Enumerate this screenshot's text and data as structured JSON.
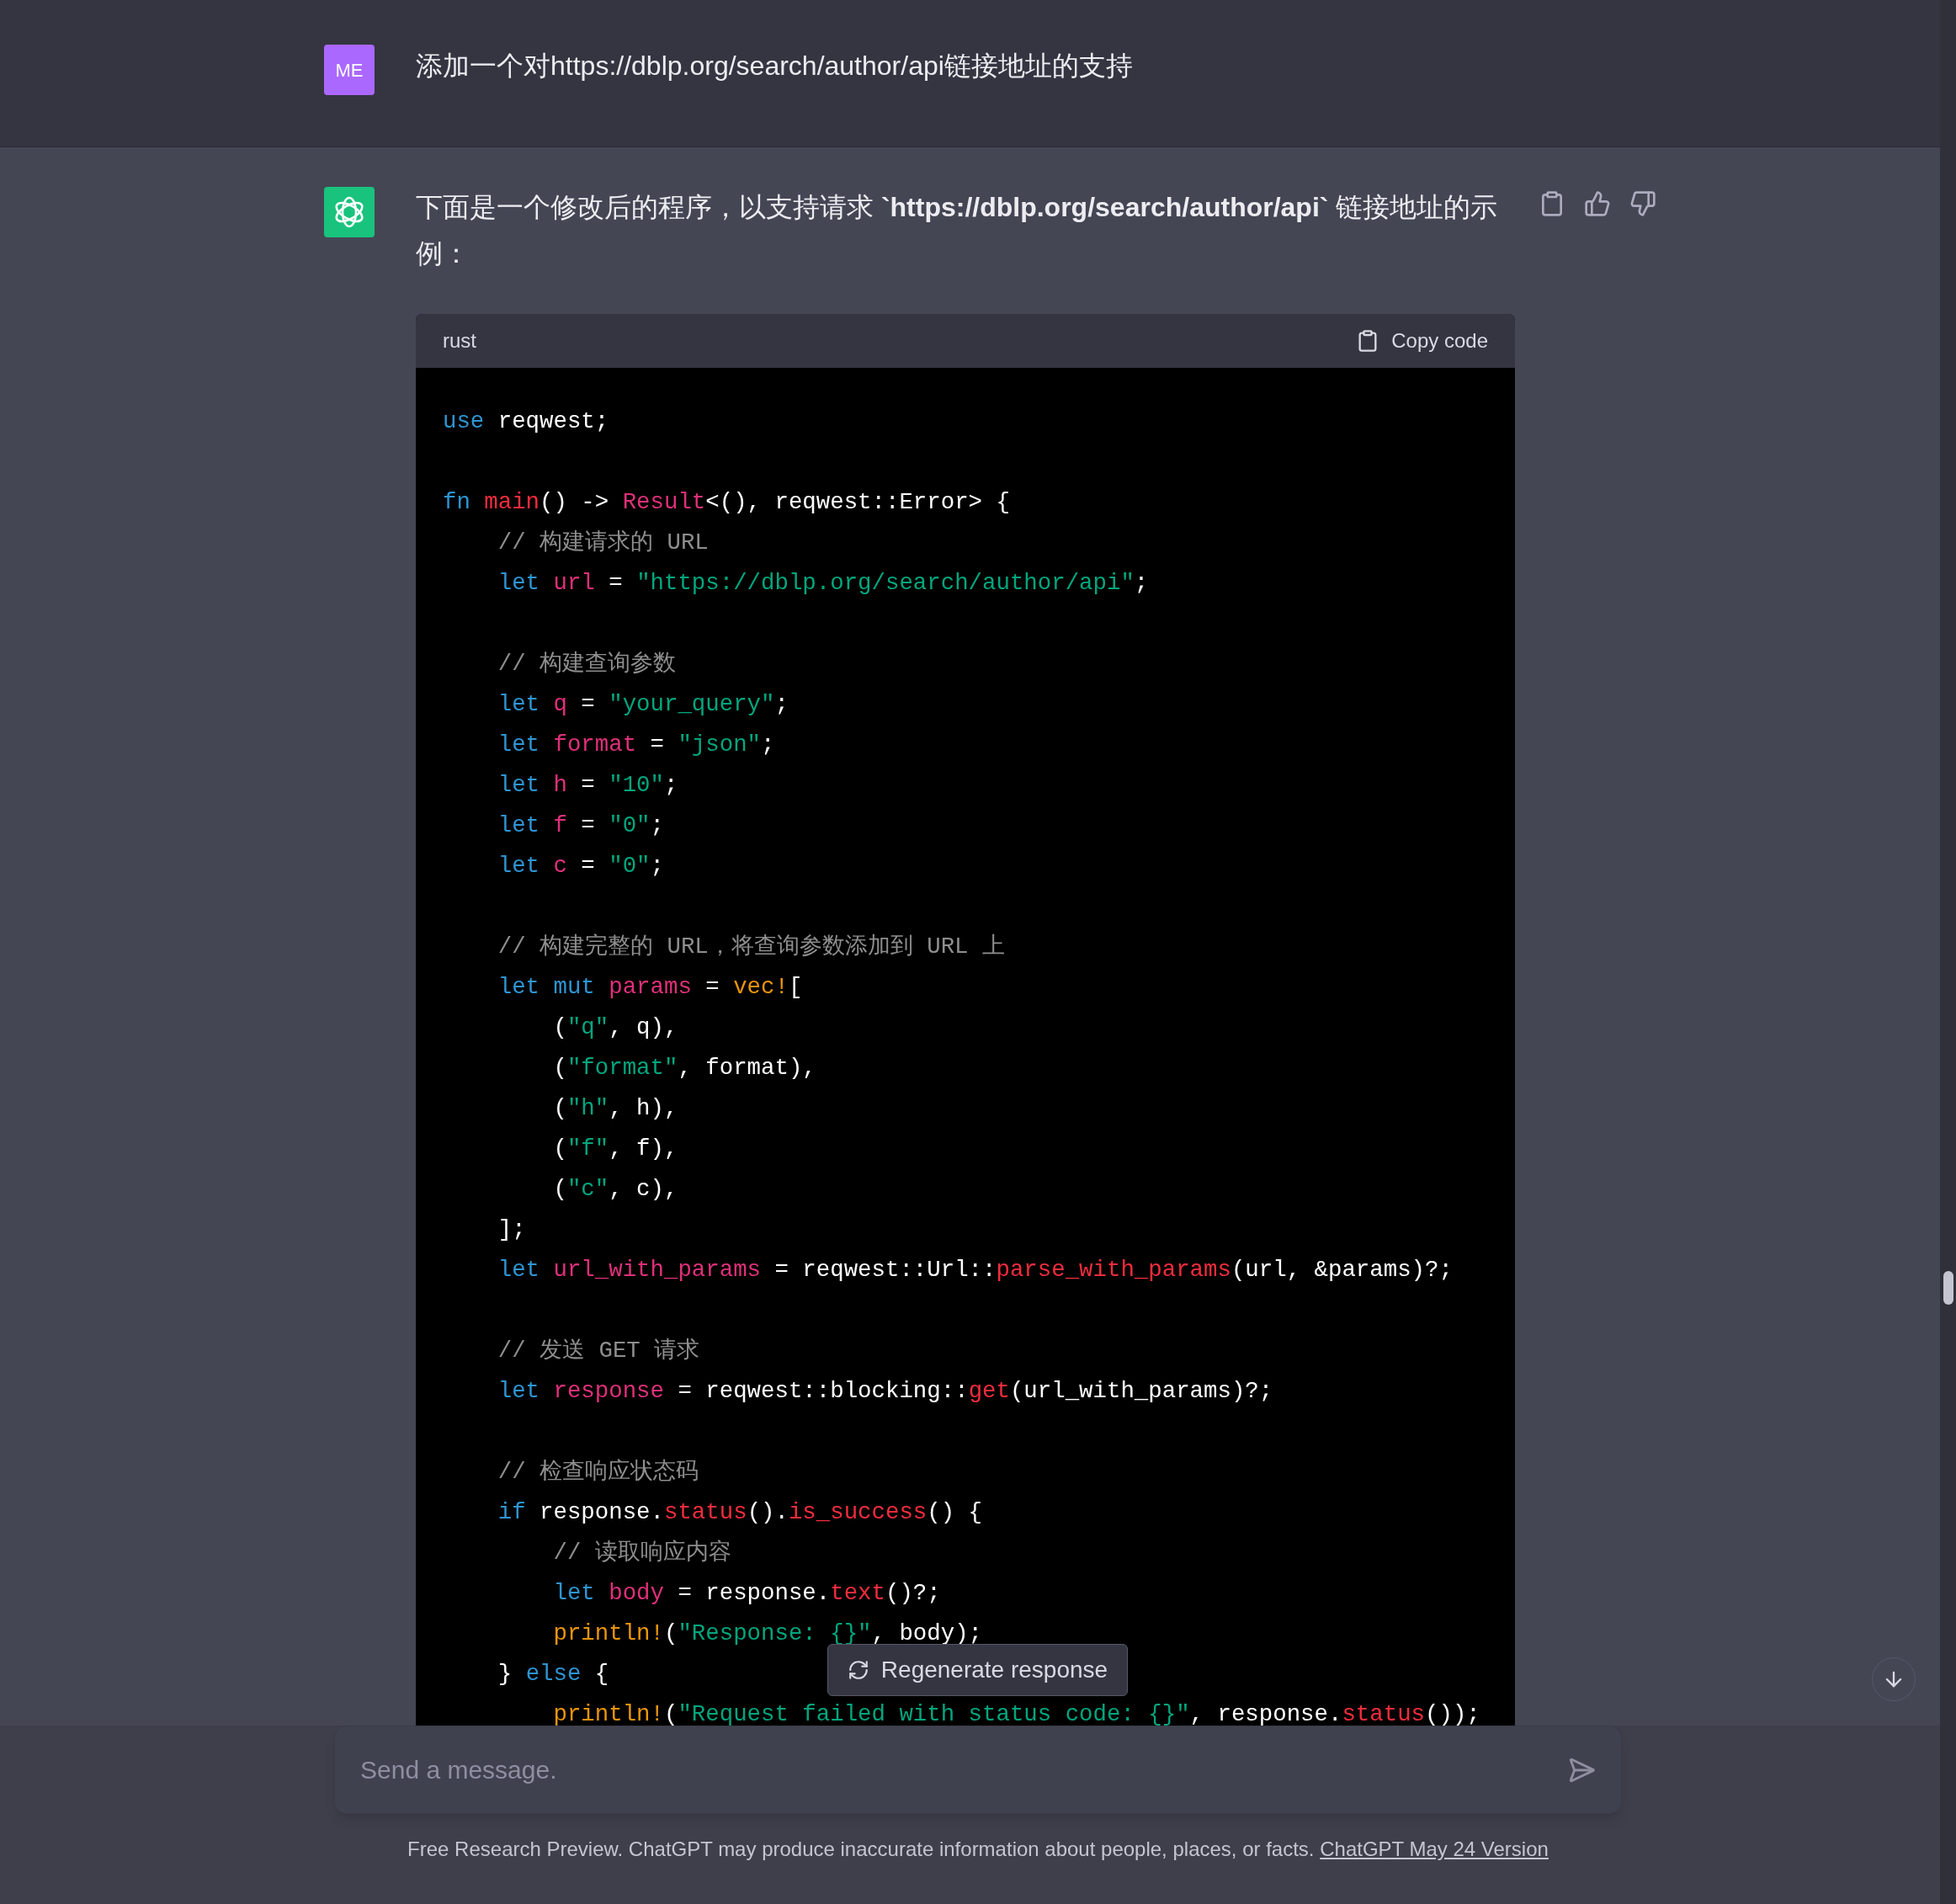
{
  "user_message": {
    "avatar": "ME",
    "text": "添加一个对https://dblp.org/search/author/api链接地址的支持"
  },
  "assistant_message": {
    "intro": "下面是一个修改后的程序，以支持请求 **`https://dblp.org/search/author/api`** 链接地址的示例：",
    "code_block": {
      "language": "rust",
      "copy_label": "Copy code",
      "lines": [
        {
          "kind": "code",
          "tokens": [
            {
              "kind": "kw",
              "text": "use"
            },
            {
              "kind": "plain",
              "text": " reqwest;"
            }
          ]
        },
        {
          "kind": "blank"
        },
        {
          "kind": "code",
          "tokens": [
            {
              "kind": "kw",
              "text": "fn "
            },
            {
              "kind": "fn",
              "text": "main"
            },
            {
              "kind": "plain",
              "text": "() -> "
            },
            {
              "kind": "type",
              "text": "Result"
            },
            {
              "kind": "plain",
              "text": "<(), reqwest::Error> {"
            }
          ]
        },
        {
          "kind": "code",
          "tokens": [
            {
              "kind": "cmt",
              "text": "    // 构建请求的 URL"
            }
          ]
        },
        {
          "kind": "code",
          "tokens": [
            {
              "kind": "kw",
              "text": "    let "
            },
            {
              "kind": "var",
              "text": "url"
            },
            {
              "kind": "plain",
              "text": " = "
            },
            {
              "kind": "str",
              "text": "\"https://dblp.org/search/author/api\""
            },
            {
              "kind": "plain",
              "text": ";"
            }
          ]
        },
        {
          "kind": "blank"
        },
        {
          "kind": "code",
          "tokens": [
            {
              "kind": "cmt",
              "text": "    // 构建查询参数"
            }
          ]
        },
        {
          "kind": "code",
          "tokens": [
            {
              "kind": "kw",
              "text": "    let "
            },
            {
              "kind": "var",
              "text": "q"
            },
            {
              "kind": "plain",
              "text": " = "
            },
            {
              "kind": "str",
              "text": "\"your_query\""
            },
            {
              "kind": "plain",
              "text": ";"
            }
          ]
        },
        {
          "kind": "code",
          "tokens": [
            {
              "kind": "kw",
              "text": "    let "
            },
            {
              "kind": "var",
              "text": "format"
            },
            {
              "kind": "plain",
              "text": " = "
            },
            {
              "kind": "str",
              "text": "\"json\""
            },
            {
              "kind": "plain",
              "text": ";"
            }
          ]
        },
        {
          "kind": "code",
          "tokens": [
            {
              "kind": "kw",
              "text": "    let "
            },
            {
              "kind": "var",
              "text": "h"
            },
            {
              "kind": "plain",
              "text": " = "
            },
            {
              "kind": "str",
              "text": "\"10\""
            },
            {
              "kind": "plain",
              "text": ";"
            }
          ]
        },
        {
          "kind": "code",
          "tokens": [
            {
              "kind": "kw",
              "text": "    let "
            },
            {
              "kind": "var",
              "text": "f"
            },
            {
              "kind": "plain",
              "text": " = "
            },
            {
              "kind": "str",
              "text": "\"0\""
            },
            {
              "kind": "plain",
              "text": ";"
            }
          ]
        },
        {
          "kind": "code",
          "tokens": [
            {
              "kind": "kw",
              "text": "    let "
            },
            {
              "kind": "var",
              "text": "c"
            },
            {
              "kind": "plain",
              "text": " = "
            },
            {
              "kind": "str",
              "text": "\"0\""
            },
            {
              "kind": "plain",
              "text": ";"
            }
          ]
        },
        {
          "kind": "blank"
        },
        {
          "kind": "code",
          "tokens": [
            {
              "kind": "cmt",
              "text": "    // 构建完整的 URL，将查询参数添加到 URL 上"
            }
          ]
        },
        {
          "kind": "code",
          "tokens": [
            {
              "kind": "kw",
              "text": "    let mut "
            },
            {
              "kind": "var",
              "text": "params"
            },
            {
              "kind": "plain",
              "text": " = "
            },
            {
              "kind": "macro",
              "text": "vec!"
            },
            {
              "kind": "plain",
              "text": "["
            }
          ]
        },
        {
          "kind": "code",
          "tokens": [
            {
              "kind": "plain",
              "text": "        ("
            },
            {
              "kind": "str",
              "text": "\"q\""
            },
            {
              "kind": "plain",
              "text": ", q),"
            }
          ]
        },
        {
          "kind": "code",
          "tokens": [
            {
              "kind": "plain",
              "text": "        ("
            },
            {
              "kind": "str",
              "text": "\"format\""
            },
            {
              "kind": "plain",
              "text": ", format),"
            }
          ]
        },
        {
          "kind": "code",
          "tokens": [
            {
              "kind": "plain",
              "text": "        ("
            },
            {
              "kind": "str",
              "text": "\"h\""
            },
            {
              "kind": "plain",
              "text": ", h),"
            }
          ]
        },
        {
          "kind": "code",
          "tokens": [
            {
              "kind": "plain",
              "text": "        ("
            },
            {
              "kind": "str",
              "text": "\"f\""
            },
            {
              "kind": "plain",
              "text": ", f),"
            }
          ]
        },
        {
          "kind": "code",
          "tokens": [
            {
              "kind": "plain",
              "text": "        ("
            },
            {
              "kind": "str",
              "text": "\"c\""
            },
            {
              "kind": "plain",
              "text": ", c),"
            }
          ]
        },
        {
          "kind": "code",
          "tokens": [
            {
              "kind": "plain",
              "text": "    ];"
            }
          ]
        },
        {
          "kind": "code",
          "tokens": [
            {
              "kind": "kw",
              "text": "    let "
            },
            {
              "kind": "var",
              "text": "url_with_params"
            },
            {
              "kind": "plain",
              "text": " = reqwest::Url::"
            },
            {
              "kind": "fn",
              "text": "parse_with_params"
            },
            {
              "kind": "plain",
              "text": "(url, &params)?;"
            }
          ]
        },
        {
          "kind": "blank"
        },
        {
          "kind": "code",
          "tokens": [
            {
              "kind": "cmt",
              "text": "    // 发送 GET 请求"
            }
          ]
        },
        {
          "kind": "code",
          "tokens": [
            {
              "kind": "kw",
              "text": "    let "
            },
            {
              "kind": "var",
              "text": "response"
            },
            {
              "kind": "plain",
              "text": " = reqwest::blocking::"
            },
            {
              "kind": "fn",
              "text": "get"
            },
            {
              "kind": "plain",
              "text": "(url_with_params)?;"
            }
          ]
        },
        {
          "kind": "blank"
        },
        {
          "kind": "code",
          "tokens": [
            {
              "kind": "cmt",
              "text": "    // 检查响应状态码"
            }
          ]
        },
        {
          "kind": "code",
          "tokens": [
            {
              "kind": "kw",
              "text": "    if"
            },
            {
              "kind": "plain",
              "text": " response."
            },
            {
              "kind": "fn",
              "text": "status"
            },
            {
              "kind": "plain",
              "text": "()."
            },
            {
              "kind": "fn",
              "text": "is_success"
            },
            {
              "kind": "plain",
              "text": "() {"
            }
          ]
        },
        {
          "kind": "code",
          "tokens": [
            {
              "kind": "cmt",
              "text": "        // 读取响应内容"
            }
          ]
        },
        {
          "kind": "code",
          "tokens": [
            {
              "kind": "kw",
              "text": "        let "
            },
            {
              "kind": "var",
              "text": "body"
            },
            {
              "kind": "plain",
              "text": " = response."
            },
            {
              "kind": "fn",
              "text": "text"
            },
            {
              "kind": "plain",
              "text": "()?;"
            }
          ]
        },
        {
          "kind": "code",
          "tokens": [
            {
              "kind": "macro",
              "text": "        println!"
            },
            {
              "kind": "plain",
              "text": "("
            },
            {
              "kind": "str",
              "text": "\"Response: {}\""
            },
            {
              "kind": "plain",
              "text": ", body);"
            }
          ]
        },
        {
          "kind": "code",
          "tokens": [
            {
              "kind": "plain",
              "text": "    } "
            },
            {
              "kind": "kw",
              "text": "else"
            },
            {
              "kind": "plain",
              "text": " {"
            }
          ]
        },
        {
          "kind": "code",
          "tokens": [
            {
              "kind": "macro",
              "text": "        println!"
            },
            {
              "kind": "plain",
              "text": "("
            },
            {
              "kind": "str",
              "text": "\"Request failed with status code: {}\""
            },
            {
              "kind": "plain",
              "text": ", response."
            },
            {
              "kind": "fn",
              "text": "status"
            },
            {
              "kind": "plain",
              "text": "());"
            }
          ]
        }
      ]
    }
  },
  "regenerate_button": "Regenerate response",
  "composer": {
    "placeholder": "Send a message."
  },
  "footer": {
    "text": "Free Research Preview. ChatGPT may produce inaccurate information about people, places, or facts.",
    "link": "ChatGPT May 24 Version"
  }
}
